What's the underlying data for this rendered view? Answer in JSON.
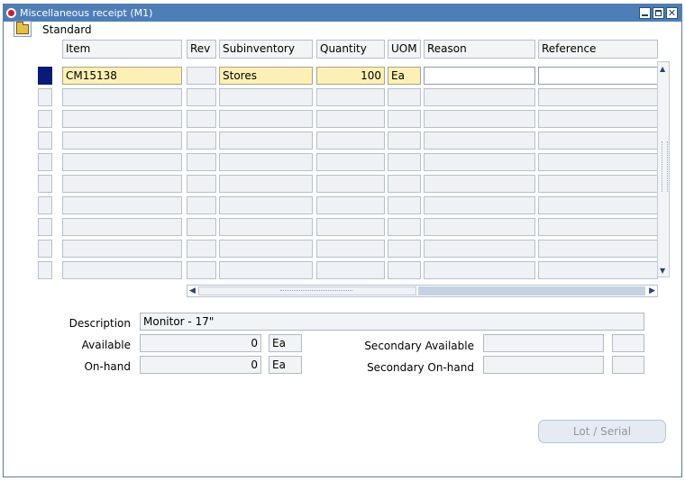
{
  "window": {
    "title": "Miscellaneous receipt (M1)",
    "controls": [
      "minimize",
      "maximize",
      "close"
    ],
    "close_glyph": "✕"
  },
  "toolbar": {
    "icon": "open-folder-icon",
    "label": "Standard"
  },
  "grid": {
    "headers": {
      "item": "Item",
      "rev": "Rev",
      "subinventory": "Subinventory",
      "quantity": "Quantity",
      "uom": "UOM",
      "reason": "Reason",
      "reference": "Reference"
    },
    "rows": [
      {
        "item": "CM15138",
        "rev": "",
        "subinventory": "Stores",
        "quantity": "100",
        "uom": "Ea",
        "reason": "",
        "reference": "",
        "selected": true
      },
      {
        "item": "",
        "rev": "",
        "subinventory": "",
        "quantity": "",
        "uom": "",
        "reason": "",
        "reference": ""
      },
      {
        "item": "",
        "rev": "",
        "subinventory": "",
        "quantity": "",
        "uom": "",
        "reason": "",
        "reference": ""
      },
      {
        "item": "",
        "rev": "",
        "subinventory": "",
        "quantity": "",
        "uom": "",
        "reason": "",
        "reference": ""
      },
      {
        "item": "",
        "rev": "",
        "subinventory": "",
        "quantity": "",
        "uom": "",
        "reason": "",
        "reference": ""
      },
      {
        "item": "",
        "rev": "",
        "subinventory": "",
        "quantity": "",
        "uom": "",
        "reason": "",
        "reference": ""
      },
      {
        "item": "",
        "rev": "",
        "subinventory": "",
        "quantity": "",
        "uom": "",
        "reason": "",
        "reference": ""
      },
      {
        "item": "",
        "rev": "",
        "subinventory": "",
        "quantity": "",
        "uom": "",
        "reason": "",
        "reference": ""
      },
      {
        "item": "",
        "rev": "",
        "subinventory": "",
        "quantity": "",
        "uom": "",
        "reason": "",
        "reference": ""
      },
      {
        "item": "",
        "rev": "",
        "subinventory": "",
        "quantity": "",
        "uom": "",
        "reason": "",
        "reference": ""
      }
    ]
  },
  "details": {
    "description_label": "Description",
    "description_value": "Monitor - 17\"",
    "available_label": "Available",
    "available_value": "0",
    "available_uom": "Ea",
    "onhand_label": "On-hand",
    "onhand_value": "0",
    "onhand_uom": "Ea",
    "secondary_available_label": "Secondary Available",
    "secondary_available_value": "",
    "secondary_available_uom": "",
    "secondary_onhand_label": "Secondary On-hand",
    "secondary_onhand_value": "",
    "secondary_onhand_uom": ""
  },
  "buttons": {
    "lot_serial": "Lot / Serial"
  },
  "colors": {
    "titlebar": "#4d7eb8",
    "selected_row_marker": "#0a1a7a",
    "editable_yellow": "#fdf0b4"
  }
}
